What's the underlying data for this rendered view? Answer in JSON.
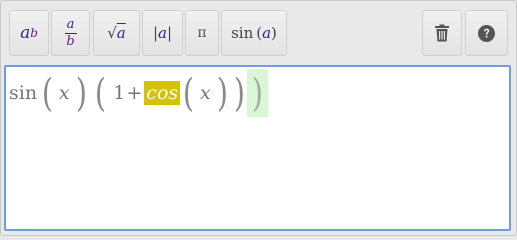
{
  "toolbar": {
    "superscript": {
      "base": "a",
      "exp": "b"
    },
    "fraction": {
      "num": "a",
      "den": "b"
    },
    "sqrt": {
      "symbol": "√",
      "arg": "a"
    },
    "abs": {
      "open": "|",
      "arg": "a",
      "close": "|"
    },
    "pi": {
      "label": "π"
    },
    "sin": {
      "fn": "sin",
      "open": "(",
      "arg": "a",
      "close": ")"
    },
    "delete_icon": "trash-icon",
    "help_icon": "help-icon"
  },
  "editor": {
    "fn_sin": "sin",
    "var_x1": "x",
    "one": "1",
    "plus": "+",
    "fn_cos": "cos",
    "var_x2": "x",
    "paren_open": "(",
    "paren_close": ")"
  },
  "colors": {
    "highlight": "#d4c400",
    "cursor_bg": "#d9f7d4",
    "focus_border": "#6b9fe0"
  }
}
